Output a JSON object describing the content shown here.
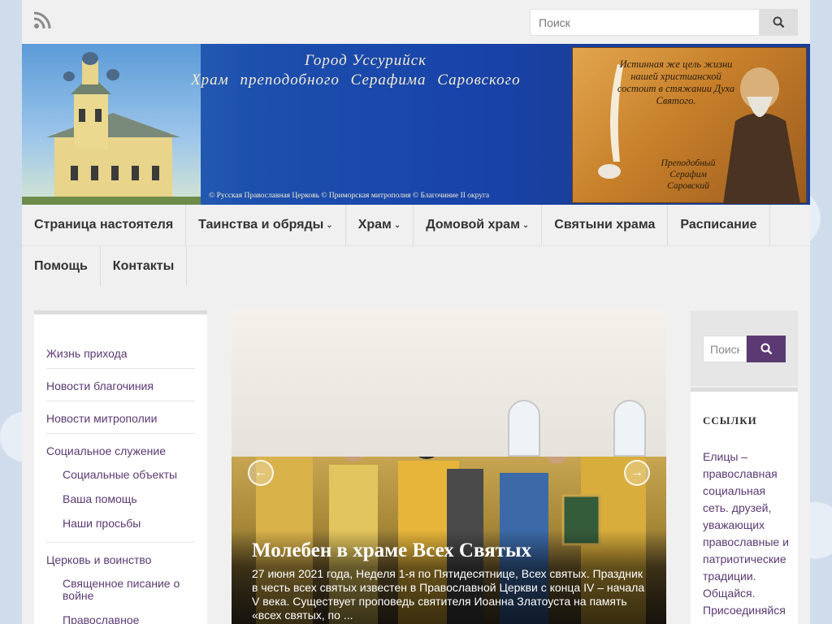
{
  "top": {
    "search_placeholder": "Поиск"
  },
  "banner": {
    "line1": "Город Уссурийск",
    "line2": "Храм преподобного Серафима Саровского",
    "credits": "© Русская Православная Церковь © Приморская митрополия © Благочиние II округа",
    "quote": "Истинная же цель жизни нашей христианской состоит в стяжании Духа Святого.",
    "signature": "Преподобный Серафим Саровский"
  },
  "nav": {
    "items": [
      {
        "label": "Страница настоятеля",
        "chevron": ""
      },
      {
        "label": "Таинства и обряды",
        "chevron": "⌄"
      },
      {
        "label": "Храм",
        "chevron": "⌄"
      },
      {
        "label": "Домовой храм",
        "chevron": "⌄"
      },
      {
        "label": "Святыни храма",
        "chevron": ""
      },
      {
        "label": "Расписание",
        "chevron": ""
      },
      {
        "label": "Помощь",
        "chevron": ""
      },
      {
        "label": "Контакты",
        "chevron": ""
      }
    ]
  },
  "sidebar": {
    "items": [
      {
        "label": "Жизнь прихода"
      },
      {
        "label": "Новости благочиния"
      },
      {
        "label": "Новости митрополии"
      },
      {
        "label": "Социальное служение",
        "sub": [
          "Социальные объекты",
          "Ваша помощь",
          "Наши просьбы"
        ]
      },
      {
        "label": "Церковь и воинство",
        "sub": [
          "Священное писание о войне",
          "Православное воинство"
        ]
      }
    ]
  },
  "slider": {
    "title": "Молебен в храме Всех Святых",
    "excerpt": "27 июня 2021 года, Неделя 1-я по Пятидесятнице, Всех святых. Праздник в честь всех святых известен в Православной Церкви с конца IV – начала V века. Существует проповедь святителя Иоанна Златоуста на память «всех святых, по ...",
    "prev_icon": "arrow-left-icon",
    "next_icon": "arrow-right-icon"
  },
  "right": {
    "search_placeholder": "Поиск",
    "links_title": "ССЫЛКИ",
    "links_text": "Елицы – православная социальная сеть. друзей, уважающих православные и патриотические традиции. Общайся. Присоединяйся"
  },
  "colors": {
    "accent": "#5b3a73",
    "nav_bg": "#f0f0f0",
    "banner_blue": "#1842a8"
  }
}
